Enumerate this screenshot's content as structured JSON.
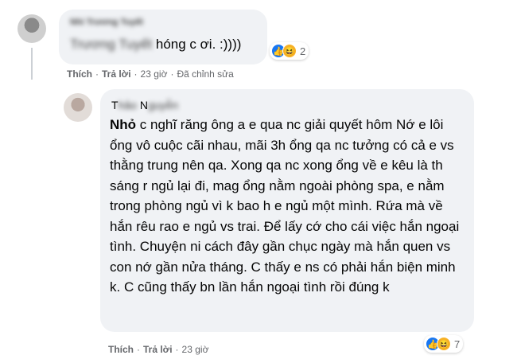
{
  "comment1": {
    "author": "Nhi Trương Tuyết",
    "text": "hóng c ơi. :))))",
    "reaction_count": "2",
    "actions": {
      "like": "Thích",
      "reply": "Trả lời",
      "time": "23 giờ",
      "edited": "Đã chỉnh sửa"
    }
  },
  "comment2": {
    "author_prefix": "T",
    "author_name_part": "N",
    "author_blur1": "hảo",
    "author_blur2": "guyễn",
    "text_first": "Nhỏ",
    "text_rest": " c nghĩ răng ông a e qua nc giải quyết hôm Nớ e lôi ổng vô cuộc cãi nhau, mãi 3h ổng qa nc tưởng có cả e vs thằng trung nên qa. Xong qa nc xong ổng về e kêu là th sáng r ngủ lại đi, mag ổng nằm ngoài phòng spa, e nằm trong phòng ngủ vì k bao h e ngủ một mình. Rứa mà về hắn rêu rao e ngủ vs trai. Để lấy cớ cho cái việc hắn ngoại tình. Chuyện ni cách đây gần chục ngày mà hắn quen vs con nớ gần nửa tháng. C thấy e ns có phải hắn biện minh k. C cũng thấy bn lần hắn ngoại tình rồi đúng k",
    "reaction_count": "7",
    "actions": {
      "like": "Thích",
      "reply": "Trả lời",
      "time": "23 giờ"
    }
  },
  "icons": {
    "like": "like-icon",
    "haha": "haha-icon"
  },
  "colors": {
    "bubble": "#f0f2f5",
    "meta": "#65676b",
    "like": "#1877f2",
    "haha": "#f7b125"
  }
}
